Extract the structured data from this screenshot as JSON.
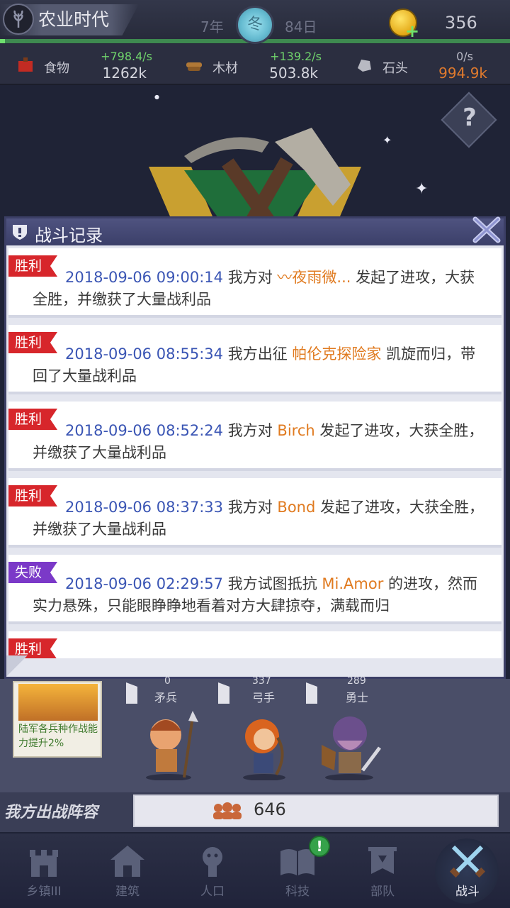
{
  "header": {
    "era_title": "农业时代",
    "year": "7年",
    "season": "冬",
    "day": "84日",
    "coins": "356",
    "era_progress": 0.01
  },
  "resources": [
    {
      "name": "食物",
      "rate": "+798.4/s",
      "amount": "1262k",
      "icon": "food-icon"
    },
    {
      "name": "木材",
      "rate": "+139.2/s",
      "amount": "503.8k",
      "icon": "wood-icon"
    },
    {
      "name": "石头",
      "rate": "0/s",
      "amount": "994.9k",
      "icon": "stone-icon"
    }
  ],
  "modal": {
    "title": "战斗记录",
    "entries": [
      {
        "result": "胜利",
        "type": "win",
        "time": "2018-09-06 09:00:14",
        "pre": " 我方对 ",
        "name": "〰夜雨微...",
        "post": " 发起了进攻，大获全胜，并缴获了大量战利品"
      },
      {
        "result": "胜利",
        "type": "win",
        "time": "2018-09-06 08:55:34",
        "pre": " 我方出征 ",
        "name": "帕伦克探险家",
        "post": " 凯旋而归，带回了大量战利品"
      },
      {
        "result": "胜利",
        "type": "win",
        "time": "2018-09-06 08:52:24",
        "pre": " 我方对 ",
        "name": "Birch",
        "post": " 发起了进攻，大获全胜，并缴获了大量战利品"
      },
      {
        "result": "胜利",
        "type": "win",
        "time": "2018-09-06 08:37:33",
        "pre": " 我方对 ",
        "name": "Bond",
        "post": " 发起了进攻，大获全胜，并缴获了大量战利品"
      },
      {
        "result": "失败",
        "type": "lose",
        "time": "2018-09-06 02:29:57",
        "pre": " 我方试图抵抗 ",
        "name": "Mi.Amor",
        "post": " 的进攻，然而实力悬殊，只能眼睁睁地看着对方大肆掠夺，满载而归"
      },
      {
        "result": "胜利",
        "type": "win",
        "time": "",
        "pre": "",
        "name": "",
        "post": ""
      }
    ]
  },
  "troops": {
    "hero_desc": "陆军各兵种作战能力提升2%",
    "units": [
      {
        "label": "矛兵",
        "count": "0"
      },
      {
        "label": "弓手",
        "count": "337"
      },
      {
        "label": "勇士",
        "count": "289"
      }
    ],
    "army_title": "我方出战阵容",
    "army_count": "646"
  },
  "nav": [
    {
      "label": "乡镇III",
      "icon": "town-icon"
    },
    {
      "label": "建筑",
      "icon": "building-icon"
    },
    {
      "label": "人口",
      "icon": "population-icon"
    },
    {
      "label": "科技",
      "icon": "tech-book-icon",
      "alert": "!"
    },
    {
      "label": "部队",
      "icon": "army-banner-icon"
    },
    {
      "label": "战斗",
      "icon": "battle-swords-icon",
      "active": true
    }
  ]
}
